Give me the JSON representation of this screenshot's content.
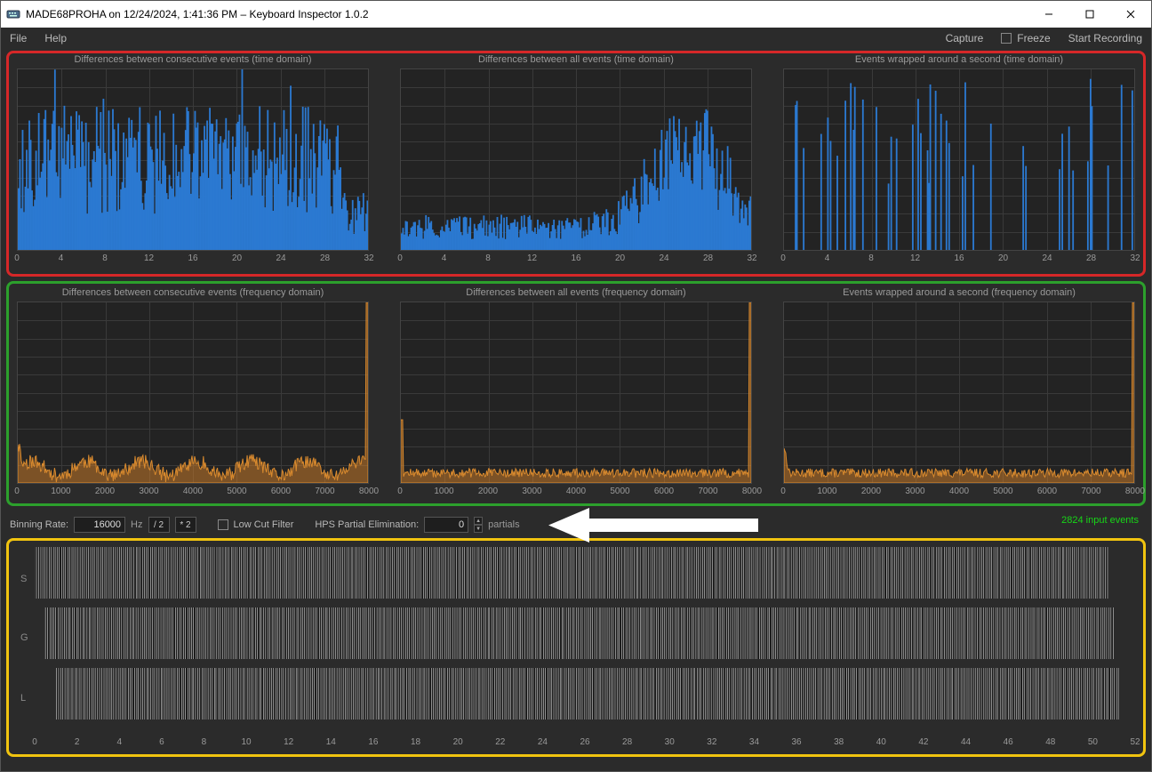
{
  "title": "MADE68PROHA on 12/24/2024, 1:41:36 PM – Keyboard Inspector 1.0.2",
  "menu": {
    "file": "File",
    "help": "Help",
    "capture": "Capture",
    "freeze": "Freeze",
    "start": "Start Recording"
  },
  "charts": {
    "row1": {
      "c1_title": "Differences between consecutive events (time domain)",
      "c2_title": "Differences between all events (time domain)",
      "c3_title": "Events wrapped around a second (time domain)",
      "xticks": [
        "0",
        "4",
        "8",
        "12",
        "16",
        "20",
        "24",
        "28",
        "32"
      ]
    },
    "row2": {
      "c1_title": "Differences between consecutive events (frequency domain)",
      "c2_title": "Differences between all events (frequency domain)",
      "c3_title": "Events wrapped around a second (frequency domain)",
      "xticks": [
        "0",
        "1000",
        "2000",
        "3000",
        "4000",
        "5000",
        "6000",
        "7000",
        "8000"
      ]
    }
  },
  "controls": {
    "binning_rate_label": "Binning Rate:",
    "binning_rate_value": "16000",
    "hz": "Hz",
    "div2": "/ 2",
    "mul2": "* 2",
    "low_cut": "Low Cut Filter",
    "hps_label": "HPS Partial Elimination:",
    "hps_value": "0",
    "partials": "partials",
    "events_label": "2824 input events"
  },
  "timeline": {
    "lanes": [
      "S",
      "G",
      "L"
    ],
    "xticks": [
      "0",
      "2",
      "4",
      "6",
      "8",
      "10",
      "12",
      "14",
      "16",
      "18",
      "20",
      "22",
      "24",
      "26",
      "28",
      "30",
      "32",
      "34",
      "36",
      "38",
      "40",
      "42",
      "44",
      "46",
      "48",
      "50",
      "52"
    ]
  },
  "chart_data": [
    {
      "type": "bar",
      "title": "Differences between consecutive events (time domain)",
      "xlabel": "",
      "ylabel": "",
      "xlim": [
        0,
        32
      ],
      "ylim": [
        0,
        220
      ],
      "note": "dense ragged histogram, values estimated",
      "values_seed": 1
    },
    {
      "type": "bar",
      "title": "Differences between all events (time domain)",
      "xlabel": "",
      "ylabel": "",
      "xlim": [
        0,
        32
      ],
      "ylim": [
        0,
        120
      ],
      "note": "low jagged floor rising toward x≈26 with a peak",
      "values_seed": 2
    },
    {
      "type": "bar",
      "title": "Events wrapped around a second (time domain)",
      "xlabel": "",
      "ylabel": "",
      "xlim": [
        0,
        32
      ],
      "ylim": [
        0,
        200
      ],
      "note": "sparse tall spikes scattered across range",
      "values_seed": 3
    },
    {
      "type": "line",
      "title": "Differences between consecutive events (frequency domain)",
      "xlabel": "",
      "ylabel": "",
      "xlim": [
        0,
        8000
      ],
      "ylim": [
        0,
        200
      ],
      "note": "near-zero floor with small bumps, massive spike at ~7950",
      "values_seed": 11
    },
    {
      "type": "line",
      "title": "Differences between all events (frequency domain)",
      "xlabel": "",
      "ylabel": "",
      "xlim": [
        0,
        8000
      ],
      "ylim": [
        0,
        200
      ],
      "note": "spike at ~0, near-flat floor, massive spike at ~7950",
      "values_seed": 12
    },
    {
      "type": "line",
      "title": "Events wrapped around a second (frequency domain)",
      "xlabel": "",
      "ylabel": "",
      "xlim": [
        0,
        8000
      ],
      "ylim": [
        0,
        200
      ],
      "note": "low noisy floor, massive spike at ~7950",
      "values_seed": 13
    },
    {
      "type": "table",
      "title": "Event timeline",
      "lanes": [
        "S",
        "G",
        "L"
      ],
      "xlim": [
        0,
        52
      ],
      "note": "three packed lanes of vertical event ticks over ~52 seconds"
    }
  ]
}
